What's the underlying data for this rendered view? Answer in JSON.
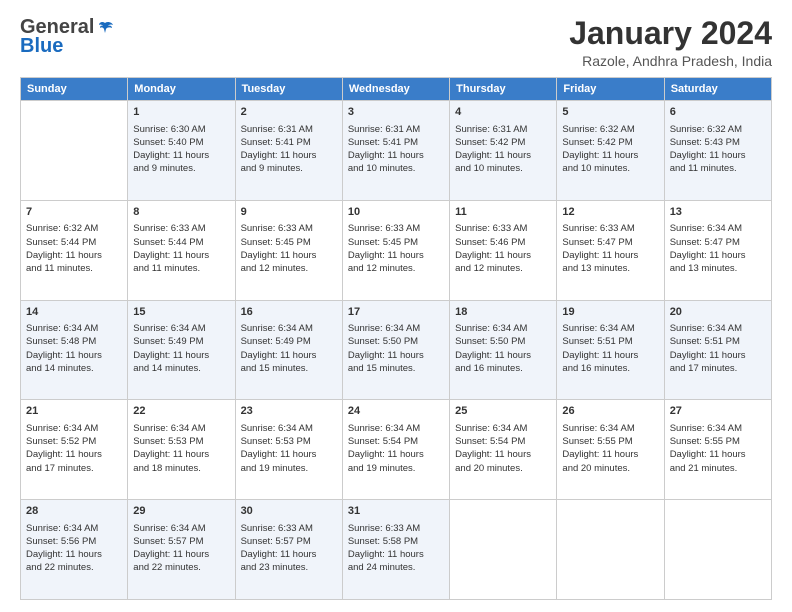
{
  "header": {
    "logo_general": "General",
    "logo_blue": "Blue",
    "month_title": "January 2024",
    "location": "Razole, Andhra Pradesh, India"
  },
  "calendar": {
    "days_of_week": [
      "Sunday",
      "Monday",
      "Tuesday",
      "Wednesday",
      "Thursday",
      "Friday",
      "Saturday"
    ],
    "weeks": [
      [
        {
          "day": "",
          "text": ""
        },
        {
          "day": "1",
          "text": "Sunrise: 6:30 AM\nSunset: 5:40 PM\nDaylight: 11 hours\nand 9 minutes."
        },
        {
          "day": "2",
          "text": "Sunrise: 6:31 AM\nSunset: 5:41 PM\nDaylight: 11 hours\nand 9 minutes."
        },
        {
          "day": "3",
          "text": "Sunrise: 6:31 AM\nSunset: 5:41 PM\nDaylight: 11 hours\nand 10 minutes."
        },
        {
          "day": "4",
          "text": "Sunrise: 6:31 AM\nSunset: 5:42 PM\nDaylight: 11 hours\nand 10 minutes."
        },
        {
          "day": "5",
          "text": "Sunrise: 6:32 AM\nSunset: 5:42 PM\nDaylight: 11 hours\nand 10 minutes."
        },
        {
          "day": "6",
          "text": "Sunrise: 6:32 AM\nSunset: 5:43 PM\nDaylight: 11 hours\nand 11 minutes."
        }
      ],
      [
        {
          "day": "7",
          "text": "Sunrise: 6:32 AM\nSunset: 5:44 PM\nDaylight: 11 hours\nand 11 minutes."
        },
        {
          "day": "8",
          "text": "Sunrise: 6:33 AM\nSunset: 5:44 PM\nDaylight: 11 hours\nand 11 minutes."
        },
        {
          "day": "9",
          "text": "Sunrise: 6:33 AM\nSunset: 5:45 PM\nDaylight: 11 hours\nand 12 minutes."
        },
        {
          "day": "10",
          "text": "Sunrise: 6:33 AM\nSunset: 5:45 PM\nDaylight: 11 hours\nand 12 minutes."
        },
        {
          "day": "11",
          "text": "Sunrise: 6:33 AM\nSunset: 5:46 PM\nDaylight: 11 hours\nand 12 minutes."
        },
        {
          "day": "12",
          "text": "Sunrise: 6:33 AM\nSunset: 5:47 PM\nDaylight: 11 hours\nand 13 minutes."
        },
        {
          "day": "13",
          "text": "Sunrise: 6:34 AM\nSunset: 5:47 PM\nDaylight: 11 hours\nand 13 minutes."
        }
      ],
      [
        {
          "day": "14",
          "text": "Sunrise: 6:34 AM\nSunset: 5:48 PM\nDaylight: 11 hours\nand 14 minutes."
        },
        {
          "day": "15",
          "text": "Sunrise: 6:34 AM\nSunset: 5:49 PM\nDaylight: 11 hours\nand 14 minutes."
        },
        {
          "day": "16",
          "text": "Sunrise: 6:34 AM\nSunset: 5:49 PM\nDaylight: 11 hours\nand 15 minutes."
        },
        {
          "day": "17",
          "text": "Sunrise: 6:34 AM\nSunset: 5:50 PM\nDaylight: 11 hours\nand 15 minutes."
        },
        {
          "day": "18",
          "text": "Sunrise: 6:34 AM\nSunset: 5:50 PM\nDaylight: 11 hours\nand 16 minutes."
        },
        {
          "day": "19",
          "text": "Sunrise: 6:34 AM\nSunset: 5:51 PM\nDaylight: 11 hours\nand 16 minutes."
        },
        {
          "day": "20",
          "text": "Sunrise: 6:34 AM\nSunset: 5:51 PM\nDaylight: 11 hours\nand 17 minutes."
        }
      ],
      [
        {
          "day": "21",
          "text": "Sunrise: 6:34 AM\nSunset: 5:52 PM\nDaylight: 11 hours\nand 17 minutes."
        },
        {
          "day": "22",
          "text": "Sunrise: 6:34 AM\nSunset: 5:53 PM\nDaylight: 11 hours\nand 18 minutes."
        },
        {
          "day": "23",
          "text": "Sunrise: 6:34 AM\nSunset: 5:53 PM\nDaylight: 11 hours\nand 19 minutes."
        },
        {
          "day": "24",
          "text": "Sunrise: 6:34 AM\nSunset: 5:54 PM\nDaylight: 11 hours\nand 19 minutes."
        },
        {
          "day": "25",
          "text": "Sunrise: 6:34 AM\nSunset: 5:54 PM\nDaylight: 11 hours\nand 20 minutes."
        },
        {
          "day": "26",
          "text": "Sunrise: 6:34 AM\nSunset: 5:55 PM\nDaylight: 11 hours\nand 20 minutes."
        },
        {
          "day": "27",
          "text": "Sunrise: 6:34 AM\nSunset: 5:55 PM\nDaylight: 11 hours\nand 21 minutes."
        }
      ],
      [
        {
          "day": "28",
          "text": "Sunrise: 6:34 AM\nSunset: 5:56 PM\nDaylight: 11 hours\nand 22 minutes."
        },
        {
          "day": "29",
          "text": "Sunrise: 6:34 AM\nSunset: 5:57 PM\nDaylight: 11 hours\nand 22 minutes."
        },
        {
          "day": "30",
          "text": "Sunrise: 6:33 AM\nSunset: 5:57 PM\nDaylight: 11 hours\nand 23 minutes."
        },
        {
          "day": "31",
          "text": "Sunrise: 6:33 AM\nSunset: 5:58 PM\nDaylight: 11 hours\nand 24 minutes."
        },
        {
          "day": "",
          "text": ""
        },
        {
          "day": "",
          "text": ""
        },
        {
          "day": "",
          "text": ""
        }
      ]
    ]
  }
}
